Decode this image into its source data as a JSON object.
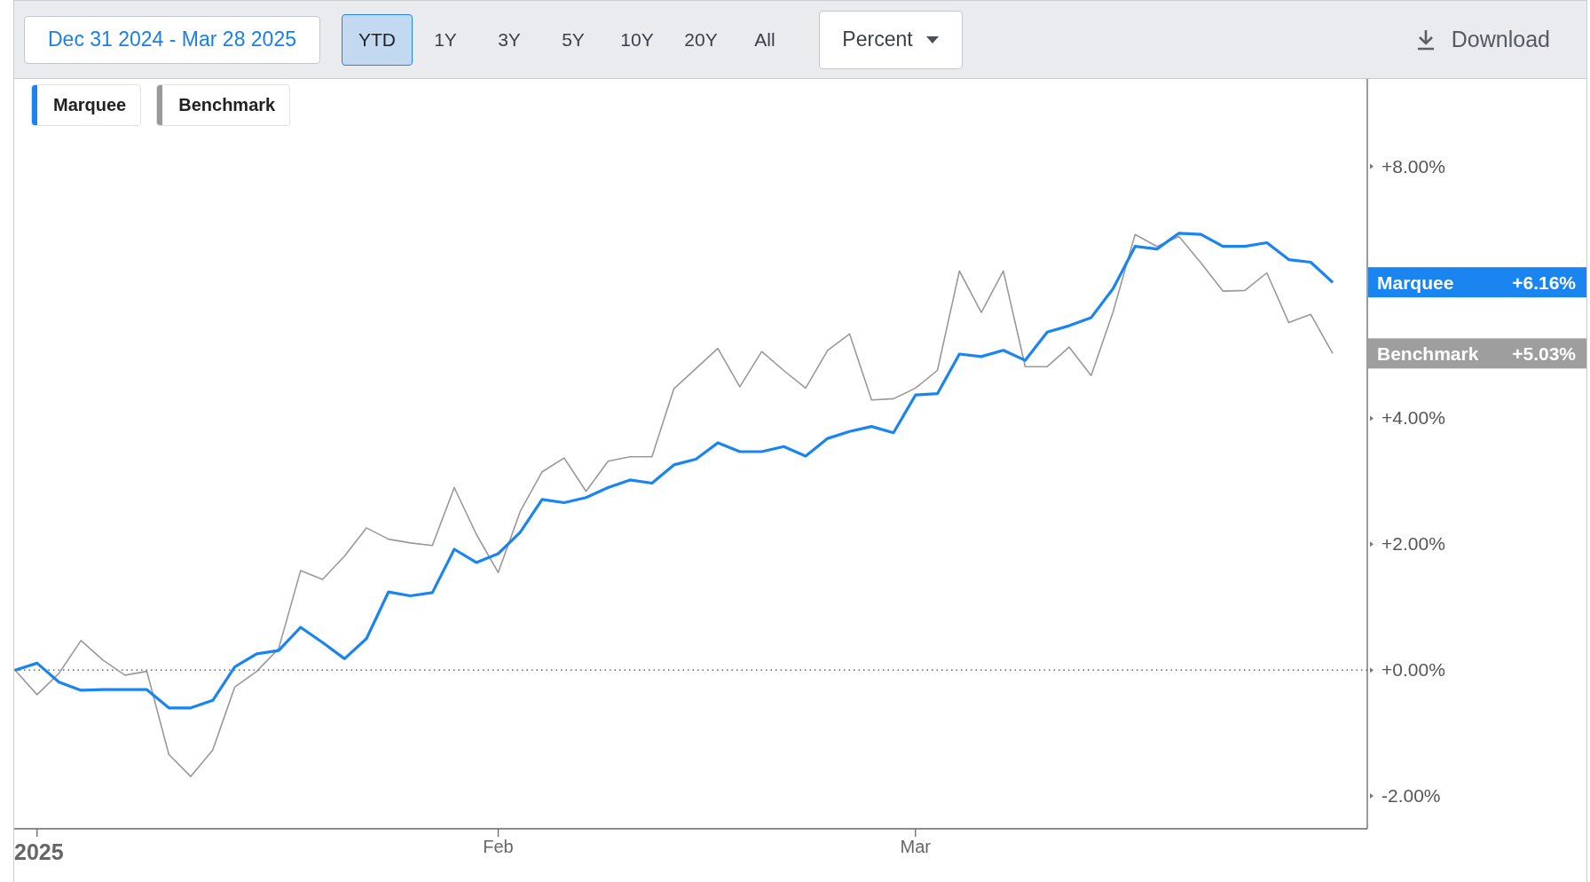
{
  "toolbar": {
    "date_range": "Dec 31 2024 - Mar 28 2025",
    "ranges": [
      {
        "label": "YTD",
        "selected": true
      },
      {
        "label": "1Y",
        "selected": false
      },
      {
        "label": "3Y",
        "selected": false
      },
      {
        "label": "5Y",
        "selected": false
      },
      {
        "label": "10Y",
        "selected": false
      },
      {
        "label": "20Y",
        "selected": false
      },
      {
        "label": "All",
        "selected": false
      }
    ],
    "unit_dropdown": "Percent",
    "download": "Download"
  },
  "chart": {
    "x_axis_labels": [
      "2025",
      "Feb",
      "Mar"
    ],
    "end_tags": [
      {
        "name": "Marquee",
        "value": "+6.16%",
        "color": "#1a84f0"
      },
      {
        "name": "Benchmark",
        "value": "+5.03%",
        "color": "#9e9e9e"
      }
    ],
    "chart_data": {
      "type": "line",
      "series": [
        {
          "name": "Marquee",
          "color": "#1a84f0",
          "values": [
            0,
            0.11,
            -0.19,
            -0.32,
            -0.31,
            -0.31,
            -0.31,
            -0.6,
            -0.6,
            -0.48,
            0.05,
            0.26,
            0.31,
            0.68,
            0.44,
            0.18,
            0.5,
            1.24,
            1.18,
            1.23,
            1.92,
            1.71,
            1.85,
            2.19,
            2.71,
            2.66,
            2.74,
            2.9,
            3.02,
            2.97,
            3.26,
            3.35,
            3.61,
            3.47,
            3.47,
            3.55,
            3.4,
            3.68,
            3.79,
            3.87,
            3.77,
            4.37,
            4.39,
            5.02,
            4.98,
            5.08,
            4.92,
            5.37,
            5.47,
            5.6,
            6.06,
            6.73,
            6.69,
            6.94,
            6.92,
            6.73,
            6.73,
            6.79,
            6.52,
            6.48,
            6.16
          ]
        },
        {
          "name": "Benchmark",
          "color": "#999999",
          "values": [
            0,
            -0.39,
            -0.05,
            0.47,
            0.16,
            -0.08,
            -0.02,
            -1.34,
            -1.69,
            -1.27,
            -0.27,
            -0.02,
            0.34,
            1.58,
            1.44,
            1.81,
            2.26,
            2.08,
            2.02,
            1.98,
            2.9,
            2.16,
            1.55,
            2.52,
            3.15,
            3.37,
            2.84,
            3.32,
            3.39,
            3.39,
            4.47,
            4.79,
            5.11,
            4.5,
            5.06,
            4.76,
            4.48,
            5.08,
            5.34,
            4.29,
            4.31,
            4.48,
            4.76,
            6.34,
            5.68,
            6.34,
            4.82,
            4.82,
            5.13,
            4.68,
            5.69,
            6.92,
            6.73,
            6.89,
            6.47,
            6.02,
            6.03,
            6.31,
            5.52,
            5.65,
            5.03
          ]
        }
      ],
      "ylim": [
        -2.52,
        9.39
      ],
      "yticks": [
        {
          "value": -2,
          "label": "-2.00%"
        },
        {
          "value": 0,
          "label": "+0.00%"
        },
        {
          "value": 2,
          "label": "+2.00%"
        },
        {
          "value": 4,
          "label": "+4.00%"
        },
        {
          "value": 8,
          "label": "+8.00%"
        }
      ]
    }
  }
}
